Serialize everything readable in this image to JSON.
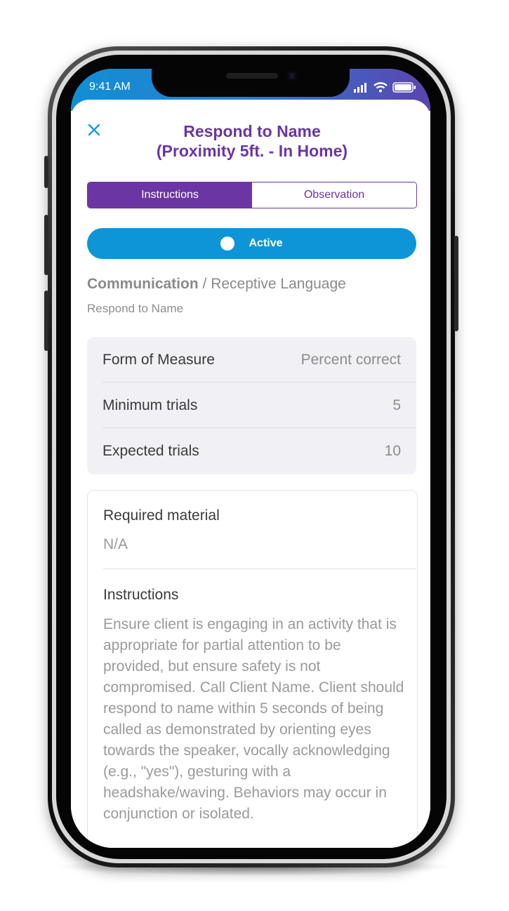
{
  "status_bar": {
    "time": "9:41 AM"
  },
  "header": {
    "close_icon": "close-icon",
    "title_line1": "Respond to Name",
    "title_line2": "(Proximity 5ft. - In Home)"
  },
  "tabs": [
    {
      "label": "Instructions",
      "selected": true
    },
    {
      "label": "Observation",
      "selected": false
    }
  ],
  "status_toggle": {
    "label": "Active"
  },
  "breadcrumb": {
    "category": "Communication",
    "separator": " / ",
    "subcategory": "Receptive Language"
  },
  "target_name": "Respond to Name",
  "measure": [
    {
      "label": "Form of Measure",
      "value": "Percent correct"
    },
    {
      "label": "Minimum trials",
      "value": "5"
    },
    {
      "label": "Expected trials",
      "value": "10"
    }
  ],
  "details": {
    "material_title": "Required material",
    "material_value": "N/A",
    "instructions_title": "Instructions",
    "instructions_text": "Ensure client is engaging in an activity that is appropriate for partial attention to be provided, but ensure safety is not compromised. Call Client Name. Client should respond to name within 5 seconds of being called as demonstrated by orienting eyes towards the speaker, vocally acknowledging (e.g., \"yes\"), gesturing with a headshake/waving. Behaviors may occur in conjunction or isolated."
  },
  "colors": {
    "accent_purple": "#6b35a3",
    "accent_blue": "#0d95d8"
  }
}
